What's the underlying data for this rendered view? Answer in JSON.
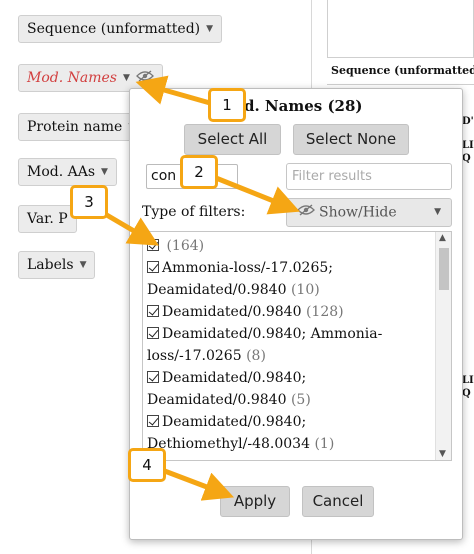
{
  "left_panel": {
    "fields": [
      {
        "label": "Sequence (unformatted)"
      },
      {
        "label": "Mod. Names"
      },
      {
        "label": "Protein name"
      },
      {
        "label": "Mod. AAs"
      },
      {
        "label": "Var. P"
      },
      {
        "label": "Labels"
      }
    ]
  },
  "table": {
    "column_header": "Sequence (unformatted)",
    "fragments": [
      "D'",
      "LI",
      "Q",
      "LI",
      "Q"
    ]
  },
  "popup": {
    "title": "d. Names (28)",
    "select_all": "Select All",
    "select_none": "Select None",
    "combo_value": "con",
    "filter_placeholder": "Filter results",
    "type_label": "Type of filters:",
    "show_hide": "Show/Hide",
    "items": [
      {
        "text": "",
        "count": "(164)"
      },
      {
        "text": "Ammonia-loss/-17.0265; Deamidated/0.9840",
        "count": "(10)"
      },
      {
        "text": "Deamidated/0.9840",
        "count": "(128)"
      },
      {
        "text": "Deamidated/0.9840; Ammonia-loss/-17.0265",
        "count": "(8)"
      },
      {
        "text": "Deamidated/0.9840; Deamidated/0.9840",
        "count": "(5)"
      },
      {
        "text": "Deamidated/0.9840; Dethiomethyl/-48.0034",
        "count": "(1)"
      }
    ],
    "apply": "Apply",
    "cancel": "Cancel"
  },
  "callouts": [
    "1",
    "2",
    "3",
    "4"
  ],
  "colors": {
    "callout_border": "#f5a614",
    "active_field": "#d24040"
  },
  "icons": [
    "eye-slash-icon",
    "chevron-down-icon",
    "checkbox-checked-icon"
  ]
}
